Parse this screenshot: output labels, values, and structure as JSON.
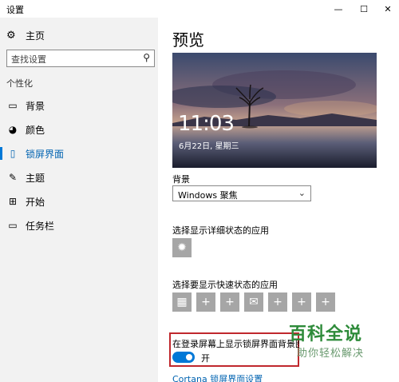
{
  "window": {
    "title": "设置",
    "min_icon": "minimize-icon",
    "max_icon": "maximize-icon",
    "close_icon": "close-icon"
  },
  "sidebar": {
    "home_label": "主页",
    "search_placeholder": "查找设置",
    "section_title": "个性化",
    "items": [
      {
        "label": "背景",
        "icon": "picture-icon",
        "active": false
      },
      {
        "label": "颜色",
        "icon": "palette-icon",
        "active": false
      },
      {
        "label": "锁屏界面",
        "icon": "lock-screen-icon",
        "active": true
      },
      {
        "label": "主题",
        "icon": "theme-icon",
        "active": false
      },
      {
        "label": "开始",
        "icon": "start-icon",
        "active": false
      },
      {
        "label": "任务栏",
        "icon": "taskbar-icon",
        "active": false
      }
    ]
  },
  "main": {
    "heading": "预览",
    "preview": {
      "time": "11:03",
      "date": "6月22日, 星期三"
    },
    "background_label": "背景",
    "background_value": "Windows 聚焦",
    "detailed_status_label": "选择显示详细状态的应用",
    "quick_status_label": "选择要显示快速状态的应用",
    "quick_tiles": [
      "calendar-icon",
      "plus-icon",
      "plus-icon",
      "mail-icon",
      "plus-icon",
      "plus-icon",
      "plus-icon"
    ],
    "show_bg_label": "在登录屏幕上显示锁屏界面背景图片",
    "toggle_state": "开",
    "cortana_link": "Cortana 锁屏界面设置"
  },
  "watermark": {
    "title": "百科全说",
    "subtitle": "助你轻松解决"
  },
  "colors": {
    "accent": "#0078d7",
    "highlight_border": "#c0282d",
    "sidebar_bg": "#f2f2f2",
    "tile_bg": "#a6a6a6"
  }
}
